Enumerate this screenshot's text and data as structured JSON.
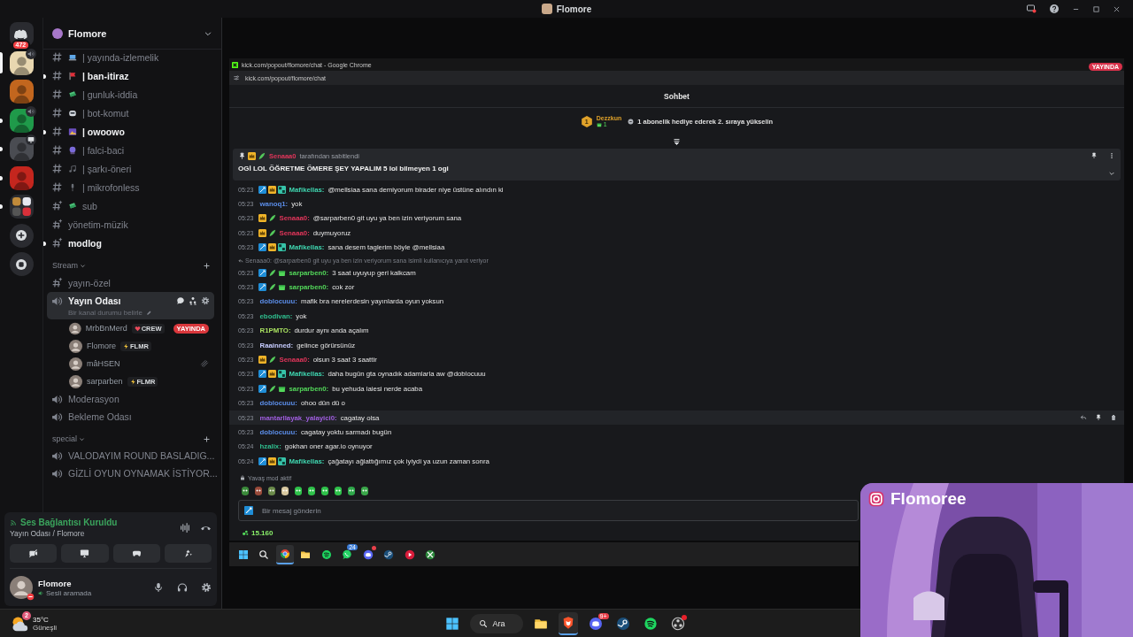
{
  "titlebar": {
    "title": "Flomore"
  },
  "servers": [
    {
      "kind": "home",
      "badge": "472",
      "selected": false,
      "unread": false
    },
    {
      "kind": "server",
      "color": "#e8d7b0",
      "selected": true,
      "unread": false,
      "activity": {
        "kind": "voice"
      }
    },
    {
      "kind": "server",
      "color": "#c2661e",
      "selected": false,
      "unread": false
    },
    {
      "kind": "server",
      "color": "#1f9a4a",
      "selected": false,
      "unread": true,
      "activity": {
        "kind": "voice"
      }
    },
    {
      "kind": "server",
      "color": "#4a4c52",
      "selected": false,
      "unread": true,
      "activity": {
        "kind": "screen"
      }
    },
    {
      "kind": "server",
      "color": "#c4261e",
      "selected": false,
      "unread": true
    },
    {
      "kind": "folder",
      "color": "#2a2b30",
      "selected": false,
      "unread": true
    },
    {
      "kind": "add",
      "selected": false,
      "unread": false
    },
    {
      "kind": "discover",
      "selected": false,
      "unread": false
    }
  ],
  "sidebar": {
    "server_name": "Flomore",
    "sections": [
      {
        "channels": [
          {
            "kind": "text",
            "emoji": true,
            "name": "| yayında-izlemelik",
            "unread": false
          },
          {
            "kind": "text",
            "emoji": true,
            "name": "| ban-itiraz",
            "unread": true
          },
          {
            "kind": "text",
            "emoji": true,
            "name": "| gunluk-iddia",
            "unread": false
          },
          {
            "kind": "text",
            "emoji": true,
            "name": "| bot-komut",
            "unread": false
          },
          {
            "kind": "text",
            "emoji": true,
            "name": "| owoowo",
            "unread": true
          },
          {
            "kind": "text",
            "emoji": true,
            "name": "| falci-baci",
            "unread": false
          },
          {
            "kind": "text",
            "emoji": true,
            "name": "| şarkı-öneri",
            "unread": false
          },
          {
            "kind": "text",
            "emoji": true,
            "name": "| mikrofonless",
            "unread": false
          },
          {
            "kind": "private",
            "emoji": true,
            "name": "sub",
            "unread": false
          },
          {
            "kind": "private",
            "name": "yönetim-müzik",
            "unread": false
          },
          {
            "kind": "private",
            "name": "modlog",
            "unread": true
          }
        ]
      },
      {
        "category": "Stream",
        "channels": [
          {
            "kind": "private",
            "name": "yayın-özel",
            "unread": false
          },
          {
            "kind": "voice",
            "name": "Yayın Odası",
            "selected": true,
            "status": "Bir kanal durumu belirle",
            "members": [
              {
                "name": "MrbBnMerd",
                "tag": {
                  "kind": "crew",
                  "text": "CREW"
                },
                "live": "YAYINDA",
                "muted": false
              },
              {
                "name": "Flomore",
                "tag": {
                  "kind": "bolt",
                  "text": "FLMR"
                },
                "muted": false
              },
              {
                "name": "mâHSEN",
                "muted": true
              },
              {
                "name": "sarparben",
                "tag": {
                  "kind": "bolt",
                  "text": "FLMR"
                },
                "muted": false
              }
            ]
          },
          {
            "kind": "voice",
            "name": "Moderasyon",
            "selected": false
          },
          {
            "kind": "voice",
            "name": "Bekleme Odası",
            "selected": false
          }
        ]
      },
      {
        "category": "special",
        "channels": [
          {
            "kind": "voice",
            "name": "VALODAYIM ROUND BASLADIG...",
            "selected": false
          },
          {
            "kind": "voice",
            "name": "GİZLİ OYUN OYNAMAK İSTİYOR...",
            "selected": false
          }
        ]
      }
    ]
  },
  "voice_panel": {
    "status": "Ses Bağlantısı Kuruldu",
    "location": "Yayın Odası / Flomore",
    "buttons": [
      {
        "kind": "camera-off"
      },
      {
        "kind": "screen"
      },
      {
        "kind": "gamepad"
      },
      {
        "kind": "activity"
      }
    ]
  },
  "user": {
    "name": "Flomore",
    "status": "Sesli aramada"
  },
  "browser": {
    "title": "kick.com/popout/flomore/chat - Google Chrome",
    "url": "kick.com/popout/flomore/chat",
    "live_badge": "YAYINDA"
  },
  "chat": {
    "header": "Sohbet",
    "leaderboard": {
      "rank": "1",
      "name": "Dezzkun",
      "count": "1",
      "prompt": "1 abonelik hediye ederek 2. sıraya yükselin"
    },
    "pinned": {
      "by": "Senaaa0",
      "color": "#e0355a",
      "badges": [
        {
          "kind": "vip"
        },
        {
          "kind": "sub"
        }
      ],
      "note": "tarafından sabitlendi",
      "text": "OGİ LOL ÖĞRETME ÖMERE ŞEY YAPALIM 5 lol bilmeyen 1 ogi"
    },
    "messages": [
      {
        "time": "05:23",
        "badges": [
          {
            "kind": "mod"
          },
          {
            "kind": "vip"
          },
          {
            "kind": "og"
          }
        ],
        "user": "Mafikellas:",
        "color": "#3fd6b0",
        "text": "@mellsiaa sana demiyorum birader niye üstüne alındın ki",
        "highlighted": false
      },
      {
        "time": "05:23",
        "user": "wanoq1:",
        "color": "#5b8de8",
        "text": "yok",
        "highlighted": false
      },
      {
        "time": "05:23",
        "badges": [
          {
            "kind": "vip"
          },
          {
            "kind": "sub"
          }
        ],
        "user": "Senaaa0:",
        "color": "#e0355a",
        "text": "@sarparben0 git uyu ya ben izin veriyorum sana",
        "highlighted": false
      },
      {
        "time": "05:23",
        "badges": [
          {
            "kind": "vip"
          },
          {
            "kind": "sub"
          }
        ],
        "user": "Senaaa0:",
        "color": "#e0355a",
        "text": "duymuyoruz",
        "highlighted": false
      },
      {
        "time": "05:23",
        "badges": [
          {
            "kind": "mod"
          },
          {
            "kind": "vip"
          },
          {
            "kind": "og"
          }
        ],
        "user": "Mafikellas:",
        "color": "#3fd6b0",
        "text": "sana desem taglerim böyle @mellsiaa",
        "highlighted": false
      },
      {
        "reply": "Senaaa0: @sarparben0 git uyu ya ben izin veriyorum sana isimli kullanıcıya yanıt veriyor",
        "time": "05:23",
        "badges": [
          {
            "kind": "mod"
          },
          {
            "kind": "sub"
          },
          {
            "kind": "gift"
          }
        ],
        "user": "sarparben0:",
        "color": "#53d85a",
        "text": "3 saat uyuyup geri kalkcam",
        "highlighted": false
      },
      {
        "time": "05:23",
        "badges": [
          {
            "kind": "mod"
          },
          {
            "kind": "sub"
          },
          {
            "kind": "gift"
          }
        ],
        "user": "sarparben0:",
        "color": "#53d85a",
        "text": "cok zor",
        "highlighted": false
      },
      {
        "time": "05:23",
        "user": "doblocuuu:",
        "color": "#5b8de8",
        "text": "mafik bra nerelerdesin yayınlarda oyun yoksun",
        "highlighted": false
      },
      {
        "time": "05:23",
        "user": "ebodivan:",
        "color": "#2fbf8f",
        "text": "yok",
        "highlighted": false
      },
      {
        "time": "05:23",
        "user": "R1PMTO:",
        "color": "#a8e060",
        "text": "durdur aynı anda açalım",
        "highlighted": false
      },
      {
        "time": "05:23",
        "user": "Raainned:",
        "color": "#c6ccff",
        "text": "gelince görürsünüz",
        "highlighted": false
      },
      {
        "time": "05:23",
        "badges": [
          {
            "kind": "vip"
          },
          {
            "kind": "sub"
          }
        ],
        "user": "Senaaa0:",
        "color": "#e0355a",
        "text": "olsun 3 saat 3 saattir",
        "highlighted": false
      },
      {
        "time": "05:23",
        "badges": [
          {
            "kind": "mod"
          },
          {
            "kind": "vip"
          },
          {
            "kind": "og"
          }
        ],
        "user": "Mafikellas:",
        "color": "#3fd6b0",
        "text": "daha bugün gta oynadık adamlarla aw @doblocuuu",
        "highlighted": false
      },
      {
        "time": "05:23",
        "badges": [
          {
            "kind": "mod"
          },
          {
            "kind": "sub"
          },
          {
            "kind": "gift"
          }
        ],
        "user": "sarparben0:",
        "color": "#53d85a",
        "text": "bu yehuda laiesi nerde acaba",
        "highlighted": false
      },
      {
        "time": "05:23",
        "user": "doblocuuu:",
        "color": "#5b8de8",
        "text": "ohoo dün dü o",
        "highlighted": false
      },
      {
        "time": "05:23",
        "user": "mantarllayak_yalayici0:",
        "color": "#a05ee0",
        "text": "cagatay olsa",
        "highlighted": true
      },
      {
        "time": "05:23",
        "user": "doblocuuu:",
        "color": "#5b8de8",
        "text": "cagatay yoktu sarmadı bugün",
        "highlighted": false
      },
      {
        "time": "05:24",
        "user": "hzalix:",
        "color": "#2fbf8f",
        "text": "gokhan oner agar.io oynuyor",
        "highlighted": false
      },
      {
        "time": "05:24",
        "badges": [
          {
            "kind": "mod"
          },
          {
            "kind": "vip"
          },
          {
            "kind": "og"
          }
        ],
        "user": "Mafikellas:",
        "color": "#3fd6b0",
        "text": "çağatayı ağlattığımız çok iyiydi ya uzun zaman sonra",
        "highlighted": false
      }
    ],
    "slow_mode": "Yavaş mod aktif",
    "emotes": [
      {
        "color": "#3a8a3a"
      },
      {
        "color": "#9a4a3a"
      },
      {
        "color": "#6a8a4a"
      },
      {
        "color": "#d8c8a0"
      },
      {
        "color": "#2ec24a"
      },
      {
        "color": "#2ec24a"
      },
      {
        "color": "#2ec24a"
      },
      {
        "color": "#2ec24a"
      },
      {
        "color": "#2ea84a"
      },
      {
        "color": "#3aa84a"
      }
    ],
    "input": {
      "placeholder": "Bir mesaj gönderin"
    },
    "points": "15.160"
  },
  "inner_taskbar": {
    "apps": [
      {
        "kind": "windows",
        "active": false
      },
      {
        "kind": "search",
        "active": false
      },
      {
        "kind": "chrome",
        "active": true
      },
      {
        "kind": "folder",
        "active": false
      },
      {
        "kind": "spotify",
        "active": false
      },
      {
        "kind": "whatsapp",
        "active": false,
        "badge": "24"
      },
      {
        "kind": "discord",
        "active": false,
        "dot": true
      },
      {
        "kind": "steam",
        "active": false
      },
      {
        "kind": "video",
        "active": false
      },
      {
        "kind": "xbox",
        "active": false
      }
    ]
  },
  "webcam": {
    "handle": "Flomoree"
  },
  "taskbar": {
    "weather": {
      "badge": "2",
      "temp": "35°C",
      "condition": "Güneşli"
    },
    "search": "Ara",
    "apps": [
      {
        "kind": "folder",
        "active": false
      },
      {
        "kind": "brave",
        "active": true
      },
      {
        "kind": "discord",
        "active": false,
        "badge": "9+"
      },
      {
        "kind": "steam",
        "active": false
      },
      {
        "kind": "spotify",
        "active": false
      },
      {
        "kind": "obs",
        "active": false,
        "dot": true
      }
    ]
  }
}
